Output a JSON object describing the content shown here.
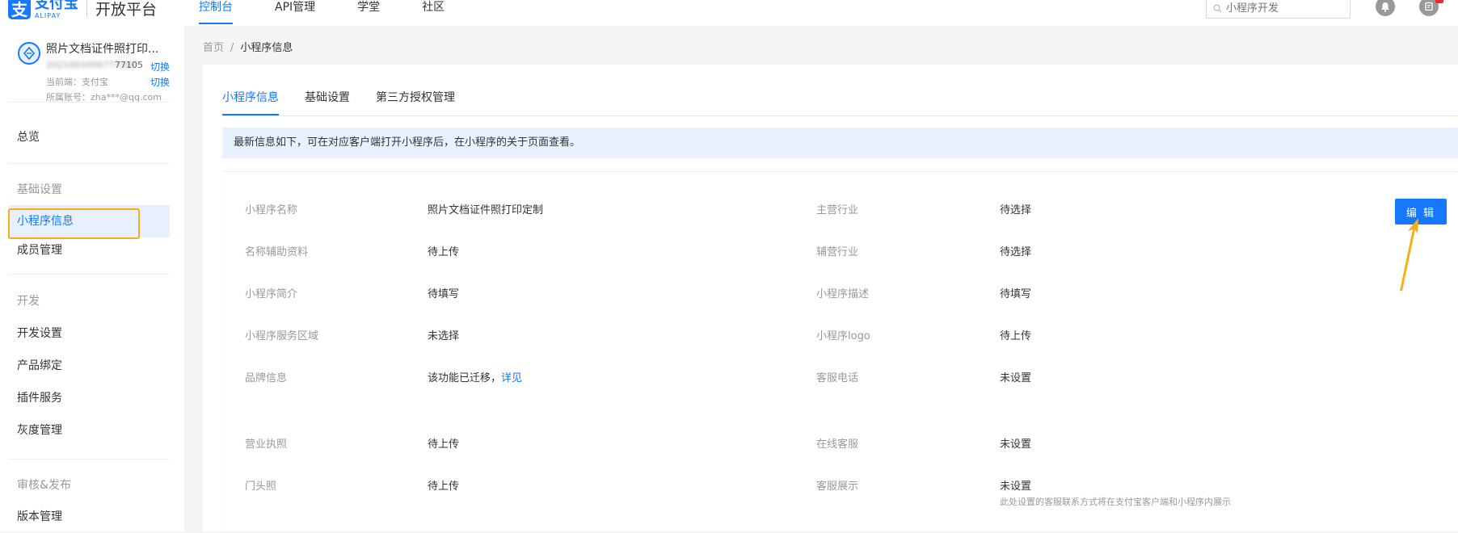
{
  "colors": {
    "accent": "#1677ff",
    "highlight": "#faad14",
    "notice_bg": "#e8f1fd",
    "badge": "#f5222d"
  },
  "brand": {
    "logo_cn": "支付宝",
    "logo_en": "ALIPAY",
    "title": "开放平台"
  },
  "topnav": {
    "items": [
      "控制台",
      "API管理",
      "学堂",
      "社区"
    ],
    "active": "控制台"
  },
  "search": {
    "placeholder": "小程序开发"
  },
  "header_icons": [
    "bell-icon",
    "message-icon"
  ],
  "app": {
    "name": "照片文档证件照打印...",
    "id": "2021003456777105",
    "id_suffix": "77105",
    "client_label": "当前端：支付宝",
    "account_label": "所属账号：zha***@qq.com",
    "switch_label": "切换"
  },
  "sidebar": {
    "overview": "总览",
    "groups": [
      {
        "title": "基础设置",
        "items": [
          "小程序信息",
          "成员管理"
        ]
      },
      {
        "title": "开发",
        "items": [
          "开发设置",
          "产品绑定",
          "插件服务",
          "灰度管理"
        ]
      },
      {
        "title": "审核&发布",
        "items": [
          "版本管理"
        ]
      }
    ],
    "active": "小程序信息"
  },
  "breadcrumb": {
    "home": "首页",
    "separator": "/",
    "current": "小程序信息"
  },
  "tabs": [
    "小程序信息",
    "基础设置",
    "第三方授权管理"
  ],
  "notice": "最新信息如下，可在对应客户端打开小程序后，在小程序的关于页面查看。",
  "info": {
    "left": [
      {
        "label": "小程序名称",
        "value": "照片文档证件照打印定制"
      },
      {
        "label": "名称辅助资料",
        "value": "待上传"
      },
      {
        "label": "小程序简介",
        "value": "待填写"
      },
      {
        "label": "小程序服务区域",
        "value": "未选择"
      },
      {
        "label": "品牌信息",
        "value": "该功能已迁移，",
        "link": "详见"
      },
      {
        "label": "营业执照",
        "value": "待上传"
      },
      {
        "label": "门头照",
        "value": "待上传"
      }
    ],
    "right": [
      {
        "label": "主营行业",
        "value": "待选择"
      },
      {
        "label": "辅营行业",
        "value": "待选择"
      },
      {
        "label": "小程序描述",
        "value": "待填写"
      },
      {
        "label": "小程序logo",
        "value": "待上传"
      },
      {
        "label": "客服电话",
        "value": "未设置"
      },
      {
        "label": "在线客服",
        "value": "未设置"
      },
      {
        "label": "客服展示",
        "value": "未设置",
        "hint": "此处设置的客服联系方式将在支付宝客户端和小程序内展示"
      }
    ]
  },
  "edit_button": "编 辑"
}
